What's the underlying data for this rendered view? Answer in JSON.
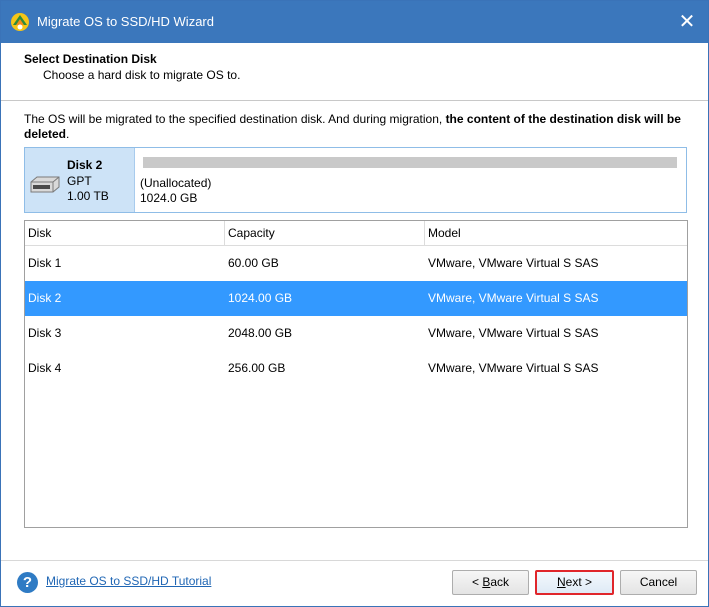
{
  "window": {
    "title": "Migrate OS to SSD/HD Wizard",
    "close_symbol": "✕",
    "accent_color": "#3b77bc"
  },
  "header": {
    "title": "Select Destination Disk",
    "subtitle": "Choose a hard disk to migrate OS to."
  },
  "notice": {
    "text": "The OS will be migrated to the specified destination disk. And during migration, ",
    "bold_text": "the content of the destination disk will be deleted",
    "end": "."
  },
  "disk_card": {
    "name": "Disk 2",
    "type": "GPT",
    "size": "1.00 TB",
    "partition_label": "(Unallocated)",
    "partition_size": "1024.0 GB",
    "icon": "hard-disk-icon"
  },
  "table": {
    "columns": [
      "Disk",
      "Capacity",
      "Model"
    ],
    "rows": [
      {
        "disk": "Disk 1",
        "capacity": "60.00 GB",
        "model": "VMware, VMware Virtual S SAS",
        "selected": false
      },
      {
        "disk": "Disk 2",
        "capacity": "1024.00 GB",
        "model": "VMware, VMware Virtual S SAS",
        "selected": true
      },
      {
        "disk": "Disk 3",
        "capacity": "2048.00 GB",
        "model": "VMware, VMware Virtual S SAS",
        "selected": false
      },
      {
        "disk": "Disk 4",
        "capacity": "256.00 GB",
        "model": "VMware, VMware Virtual S SAS",
        "selected": false
      }
    ],
    "selected_color": "#3399ff"
  },
  "footer": {
    "help_icon": "question-icon",
    "help_symbol": "?",
    "tutorial_link": "Migrate OS to SSD/HD Tutorial",
    "back_prefix": "< ",
    "back_key": "B",
    "back_rest": "ack",
    "next_key": "N",
    "next_rest": "ext >",
    "cancel_label": "Cancel",
    "highlight_color": "#e0262b"
  }
}
